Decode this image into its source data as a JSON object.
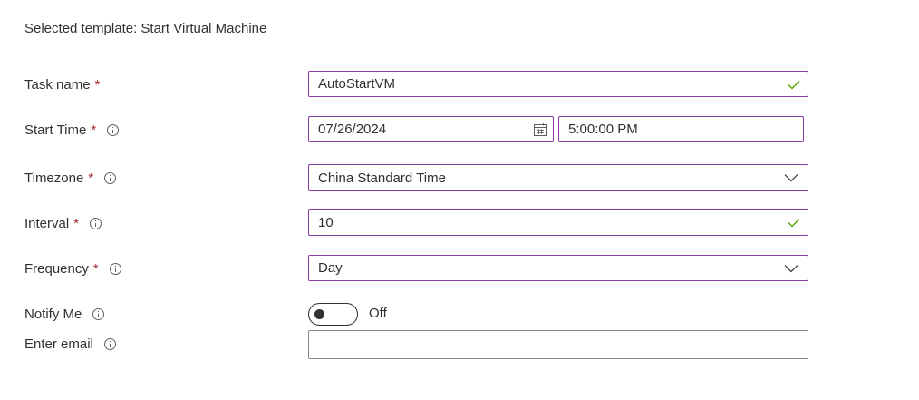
{
  "header": {
    "selected_template": "Selected template: Start Virtual Machine"
  },
  "form": {
    "task_name": {
      "label": "Task name",
      "required_mark": "*",
      "value": "AutoStartVM"
    },
    "start_time": {
      "label": "Start Time",
      "required_mark": "*",
      "date_value": "07/26/2024",
      "time_value": "5:00:00 PM"
    },
    "timezone": {
      "label": "Timezone",
      "required_mark": "*",
      "value": "China Standard Time"
    },
    "interval": {
      "label": "Interval",
      "required_mark": "*",
      "value": "10"
    },
    "frequency": {
      "label": "Frequency",
      "required_mark": "*",
      "value": "Day"
    },
    "notify_me": {
      "label": "Notify Me",
      "state_text": "Off"
    },
    "email": {
      "label": "Enter email",
      "value": ""
    }
  },
  "colors": {
    "focus_border": "#8a3aa3",
    "required": "#a4262c",
    "valid_check": "#57a300",
    "text": "#323130"
  },
  "icons": {
    "info": "info-icon",
    "check": "checkmark-icon",
    "chevron": "chevron-down-icon",
    "calendar": "calendar-icon"
  }
}
